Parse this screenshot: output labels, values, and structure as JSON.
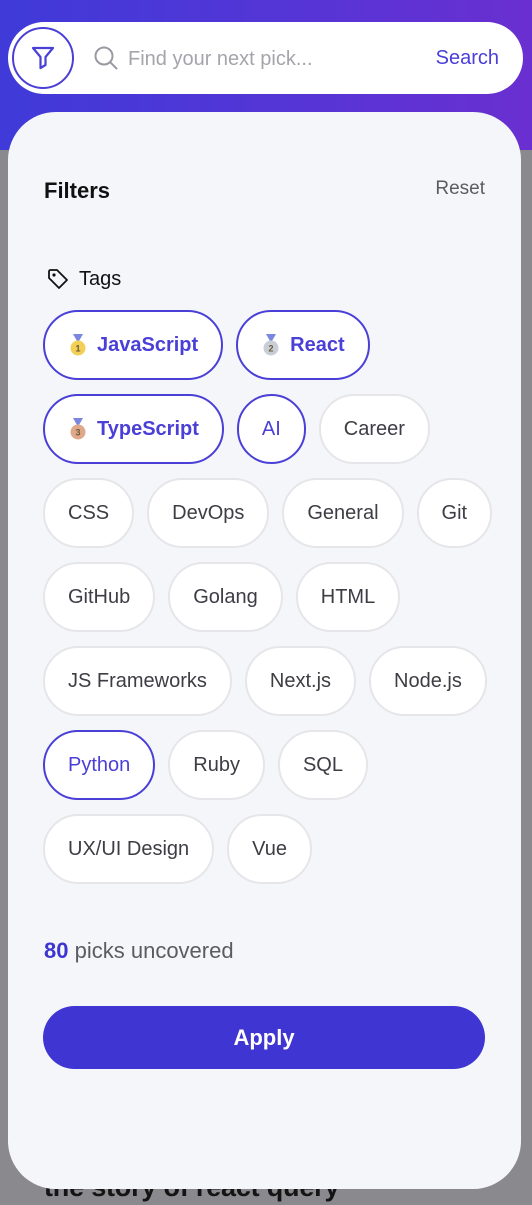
{
  "background": {
    "peek_text": "the story of react query"
  },
  "search": {
    "placeholder": "Find your next pick...",
    "button_label": "Search"
  },
  "filters": {
    "title": "Filters",
    "reset_label": "Reset",
    "tags_label": "Tags",
    "tags": [
      {
        "label": "JavaScript",
        "selected": true,
        "medal": "gold-medal-icon",
        "rank": "1"
      },
      {
        "label": "React",
        "selected": true,
        "medal": "silver-medal-icon",
        "rank": "2"
      },
      {
        "label": "TypeScript",
        "selected": true,
        "medal": "bronze-medal-icon",
        "rank": "3"
      },
      {
        "label": "AI",
        "selected": true
      },
      {
        "label": "Career",
        "selected": false
      },
      {
        "label": "CSS",
        "selected": false
      },
      {
        "label": "DevOps",
        "selected": false
      },
      {
        "label": "General",
        "selected": false
      },
      {
        "label": "Git",
        "selected": false
      },
      {
        "label": "GitHub",
        "selected": false
      },
      {
        "label": "Golang",
        "selected": false
      },
      {
        "label": "HTML",
        "selected": false
      },
      {
        "label": "JS Frameworks",
        "selected": false
      },
      {
        "label": "Next.js",
        "selected": false
      },
      {
        "label": "Node.js",
        "selected": false
      },
      {
        "label": "Python",
        "selected": true
      },
      {
        "label": "Ruby",
        "selected": false
      },
      {
        "label": "SQL",
        "selected": false
      },
      {
        "label": "UX/UI Design",
        "selected": false
      },
      {
        "label": "Vue",
        "selected": false
      }
    ],
    "result_count": "80",
    "result_suffix": "picks uncovered",
    "apply_label": "Apply"
  },
  "colors": {
    "accent": "#4a3fd6",
    "apply_bg": "#3f35d2",
    "panel_bg": "#f5f6fa",
    "gold": "#f3cf55",
    "silver": "#c9ced6",
    "bronze": "#e0a88a"
  }
}
